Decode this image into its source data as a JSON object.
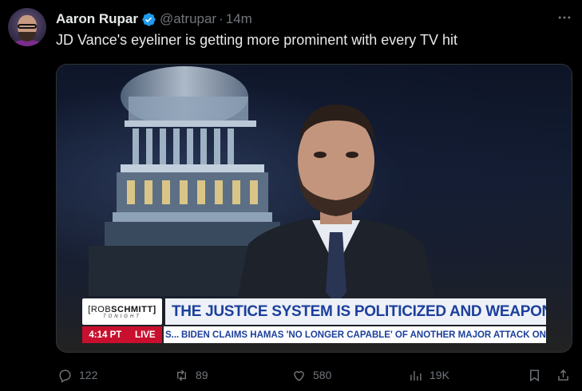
{
  "author": {
    "name": "Aaron Rupar",
    "handle": "@atrupar",
    "separator": "·",
    "time": "14m"
  },
  "tweet": {
    "text": "JD Vance's eyeliner is getting more prominent with every TV hit"
  },
  "media": {
    "brand_line1_a": "[ROB",
    "brand_line1_b": "SCHMITT]",
    "brand_line2": "TONIGHT",
    "headline": "THE JUSTICE SYSTEM IS POLITICIZED AND WEAPONIZED",
    "time": "4:14 PT",
    "live": "LIVE",
    "ticker_prefix": "S...",
    "ticker": "BIDEN CLAIMS HAMAS 'NO LONGER CAPABLE' OF ANOTHER MAJOR ATTACK ON"
  },
  "actions": {
    "replies": "122",
    "reposts": "89",
    "likes": "580",
    "views": "19K"
  },
  "colors": {
    "background": "#000000",
    "text_primary": "#e7e9ea",
    "text_secondary": "#71767b",
    "verified": "#1d9bf0",
    "headline_blue": "#1b3f9b",
    "live_red": "#c8102e"
  },
  "icons": [
    "verified-badge-icon",
    "more-options-icon",
    "reply-icon",
    "repost-icon",
    "like-icon",
    "views-icon",
    "bookmark-icon",
    "share-icon"
  ]
}
